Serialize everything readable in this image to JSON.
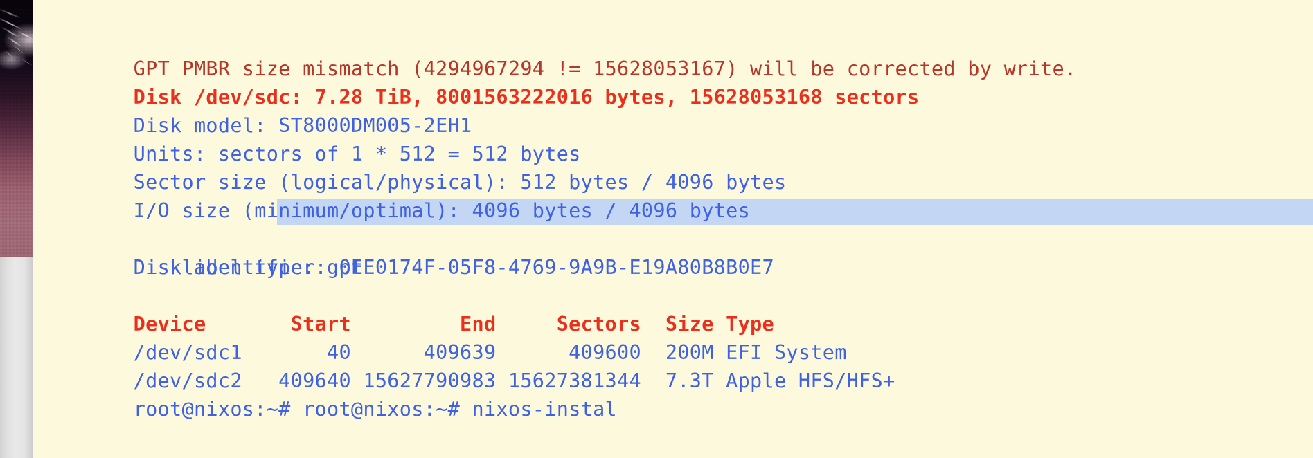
{
  "terminal": {
    "background_color": "#fcf9dd",
    "selection_color": "#c3d7f5",
    "warn_color": "#b4372a",
    "red_color": "#e8301c",
    "blue_color": "#4062e0",
    "lines": [
      {
        "id": "pmbr-warning",
        "text": "GPT PMBR size mismatch (4294967294 != 15628053167) will be corrected by write."
      },
      {
        "id": "disk-summary",
        "text": "Disk /dev/sdc: 7.28 TiB, 8001563222016 bytes, 15628053168 sectors"
      },
      {
        "id": "disk-model",
        "text": "Disk model: ST8000DM005-2EH1"
      },
      {
        "id": "units",
        "text": "Units: sectors of 1 * 512 = 512 bytes"
      },
      {
        "id": "sector-size",
        "text": "Sector size (logical/physical): 512 bytes / 4096 bytes"
      },
      {
        "id": "io-size",
        "text": "I/O size (minimum/optimal): 4096 bytes / 4096 bytes"
      },
      {
        "id": "disklabel",
        "text": "Disklabel type: gpt"
      },
      {
        "id": "disk-id",
        "text": "Disk identifier: 0EE0174F-05F8-4769-9A9B-E19A80B8B0E7"
      },
      {
        "id": "blank-1",
        "text": ""
      },
      {
        "id": "table-header",
        "text": "Device       Start         End     Sectors  Size Type"
      },
      {
        "id": "part-1",
        "text": "/dev/sdc1       40      409639      409600  200M EFI System"
      },
      {
        "id": "part-2",
        "text": "/dev/sdc2   409640 15627790983 15627381344  7.3T Apple HFS/HFS+"
      },
      {
        "id": "prompt-line",
        "text": "root@nixos:~# root@nixos:~# nixos-instal"
      }
    ],
    "table": {
      "columns": [
        "Device",
        "Start",
        "End",
        "Sectors",
        "Size",
        "Type"
      ],
      "rows": [
        {
          "device": "/dev/sdc1",
          "start": "40",
          "end": "409639",
          "sectors": "409600",
          "size": "200M",
          "type": "EFI System"
        },
        {
          "device": "/dev/sdc2",
          "start": "409640",
          "end": "15627790983",
          "sectors": "15627381344",
          "size": "7.3T",
          "type": "Apple HFS/HFS+"
        }
      ]
    },
    "disk": {
      "device": "/dev/sdc",
      "size_human": "7.28 TiB",
      "size_bytes": "8001563222016",
      "sectors": "15628053168",
      "model": "ST8000DM005-2EH1",
      "units": "sectors of 1 * 512 = 512 bytes",
      "logical_sector_size": "512 bytes",
      "physical_sector_size": "4096 bytes",
      "io_min": "4096 bytes",
      "io_optimal": "4096 bytes",
      "disklabel_type": "gpt",
      "identifier": "0EE0174F-05F8-4769-9A9B-E19A80B8B0E7",
      "pmbr_actual": "4294967294",
      "pmbr_expected": "15628053167"
    }
  },
  "desktop": {
    "wallpaper_name": "night-sky-wallpaper",
    "window_edge_name": "window-left-edge"
  }
}
